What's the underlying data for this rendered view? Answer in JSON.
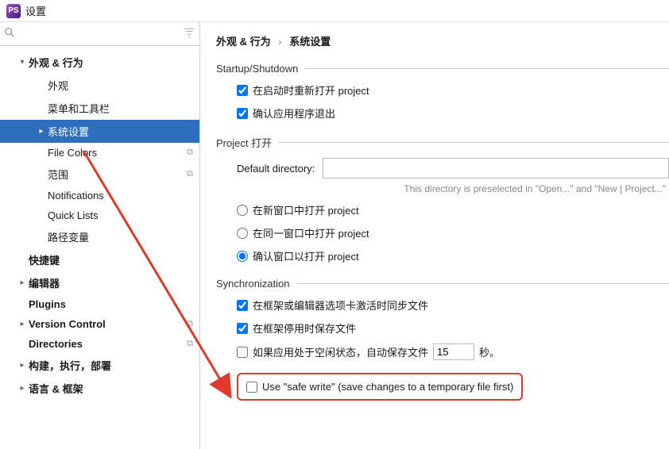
{
  "window": {
    "title": "设置"
  },
  "search": {
    "placeholder": ""
  },
  "tree": {
    "items": [
      {
        "label": "外观 & 行为",
        "level": 1,
        "chev": "down"
      },
      {
        "label": "外观",
        "level": 2,
        "chev": "none"
      },
      {
        "label": "菜单和工具栏",
        "level": 2,
        "chev": "none"
      },
      {
        "label": "系统设置",
        "level": 2,
        "chev": "right",
        "selected": true
      },
      {
        "label": "File Colors",
        "level": 2,
        "chev": "none",
        "copy": true
      },
      {
        "label": "范围",
        "level": 2,
        "chev": "none",
        "copy": true
      },
      {
        "label": "Notifications",
        "level": 2,
        "chev": "none"
      },
      {
        "label": "Quick Lists",
        "level": 2,
        "chev": "none"
      },
      {
        "label": "路径变量",
        "level": 2,
        "chev": "none"
      },
      {
        "label": "快捷键",
        "level": 1,
        "chev": "none"
      },
      {
        "label": "编辑器",
        "level": 1,
        "chev": "right"
      },
      {
        "label": "Plugins",
        "level": 1,
        "chev": "none"
      },
      {
        "label": "Version Control",
        "level": 1,
        "chev": "right",
        "copy": true
      },
      {
        "label": "Directories",
        "level": 1,
        "chev": "none",
        "copy": true
      },
      {
        "label": "构建，执行，部署",
        "level": 1,
        "chev": "right"
      },
      {
        "label": "语言 & 框架",
        "level": 1,
        "chev": "right"
      }
    ]
  },
  "breadcrumb": {
    "a": "外观 & 行为",
    "b": "系统设置"
  },
  "startup": {
    "legend": "Startup/Shutdown",
    "reopen": "在启动时重新打开 project",
    "confirm_exit": "确认应用程序退出"
  },
  "project_open": {
    "legend": "Project 打开",
    "dir_label": "Default directory:",
    "dir_value": "",
    "hint": "This directory is preselected in \"Open...\" and \"New | Project...\"",
    "opt_new": "在新窗口中打开 project",
    "opt_same": "在同一窗口中打开 project",
    "opt_confirm": "确认窗口以打开 project"
  },
  "sync": {
    "legend": "Synchronization",
    "on_activate": "在框架或编辑器选项卡激活时同步文件",
    "on_deactivate": "在框架停用时保存文件",
    "idle_pre": "如果应用处于空闲状态，自动保存文件",
    "idle_value": "15",
    "idle_post": "秒。",
    "safe_write": "Use \"safe write\" (save changes to a temporary file first)"
  },
  "watermark": ""
}
